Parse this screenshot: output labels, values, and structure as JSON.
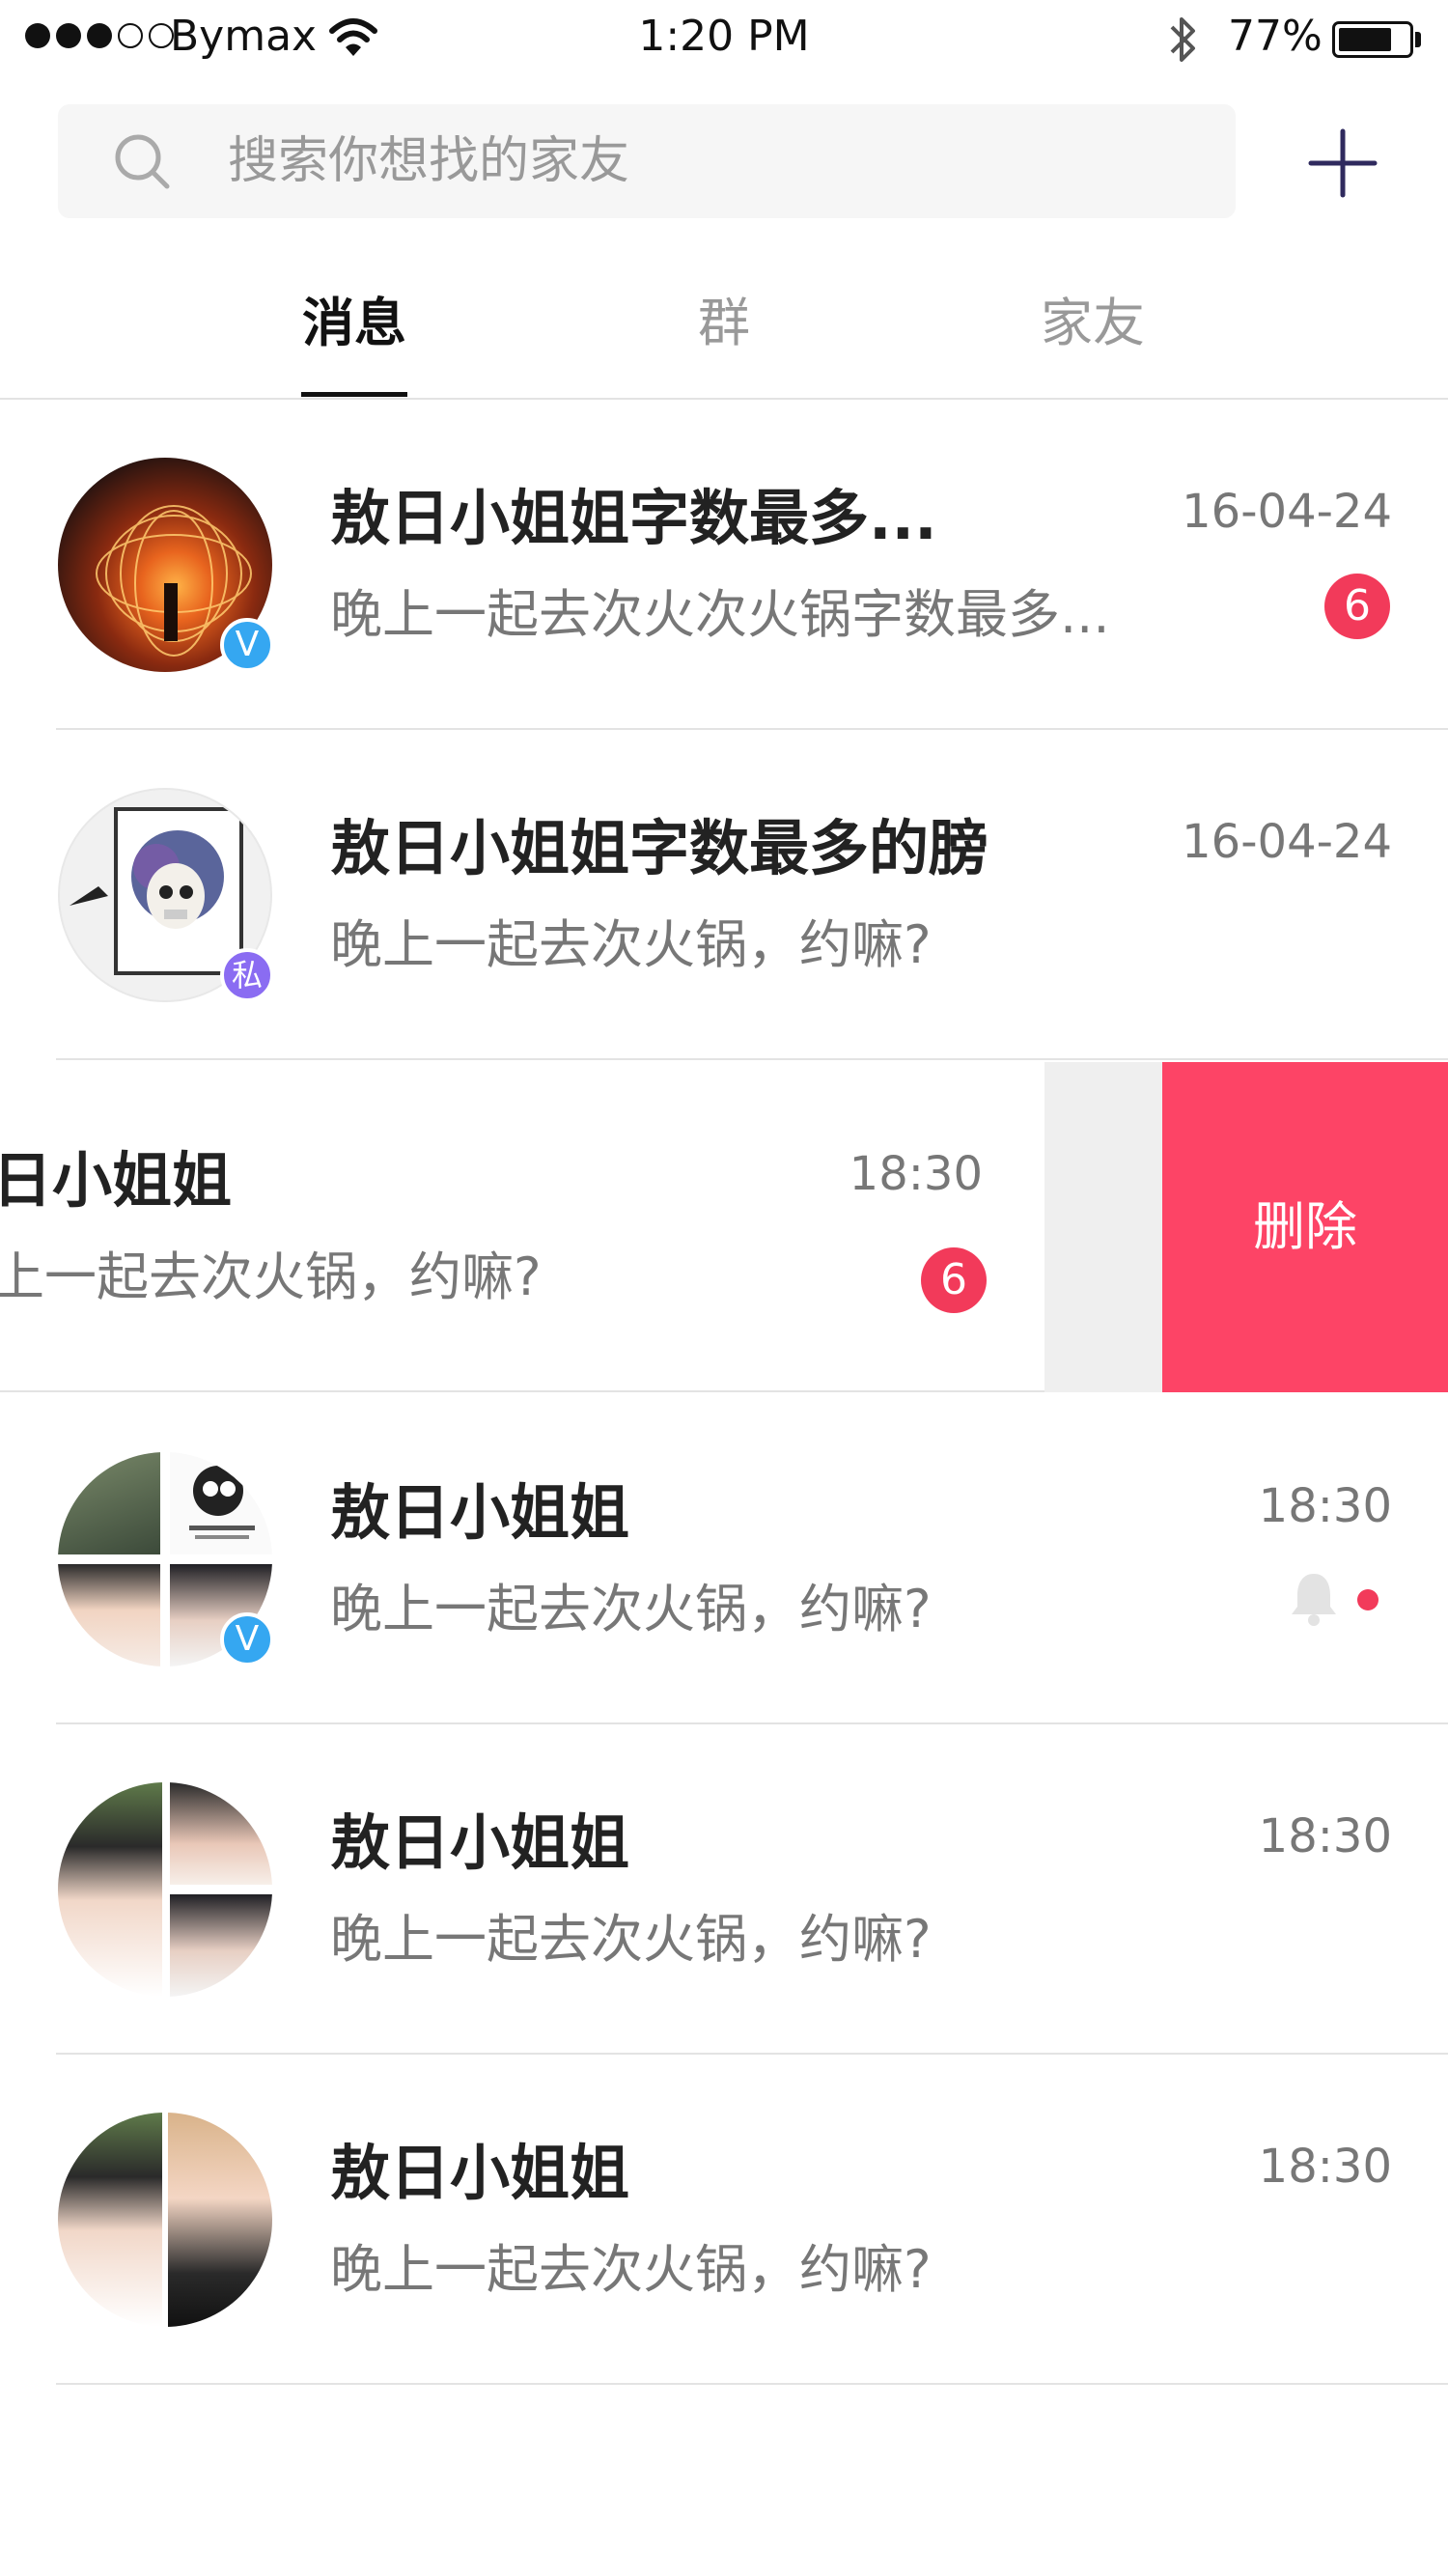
{
  "status_bar": {
    "carrier": "Bymax",
    "time": "1:20 PM",
    "battery_percent": "77%",
    "battery_level": 0.77,
    "bluetooth_icon": "bluetooth-icon",
    "wifi_icon": "wifi-icon"
  },
  "search": {
    "placeholder": "搜索你想找的家友",
    "icon": "search-icon"
  },
  "add_button": {
    "icon": "plus-icon"
  },
  "tabs": [
    {
      "label": "消息",
      "active": true
    },
    {
      "label": "群",
      "active": false
    },
    {
      "label": "家友",
      "active": false
    }
  ],
  "conversations": [
    {
      "name": "敖日小姐姐字数最多...",
      "preview": "晚上一起去次火次火锅字数最多...",
      "time": "16-04-24",
      "unread": "6",
      "badge": "V"
    },
    {
      "name": "敖日小姐姐字数最多的膀",
      "preview": "晚上一起去次火锅，约嘛?",
      "time": "16-04-24",
      "badge": "私"
    },
    {
      "name": "日小姐姐",
      "preview": "上一起去次火锅，约嘛?",
      "time": "18:30",
      "unread": "6",
      "delete_label": "删除"
    },
    {
      "name": "敖日小姐姐",
      "preview": "晚上一起去次火锅，约嘛?",
      "time": "18:30",
      "muted": true,
      "badge": "V"
    },
    {
      "name": "敖日小姐姐",
      "preview": "晚上一起去次火锅，约嘛?",
      "time": "18:30"
    },
    {
      "name": "敖日小姐姐",
      "preview": "晚上一起去次火锅，约嘛?",
      "time": "18:30"
    }
  ],
  "colors": {
    "accent_red": "#f23a5a",
    "delete_red": "#fd4466",
    "verified_blue": "#35a7f1",
    "private_purple": "#8a6cf2",
    "plus_icon": "#2f2a5e"
  }
}
